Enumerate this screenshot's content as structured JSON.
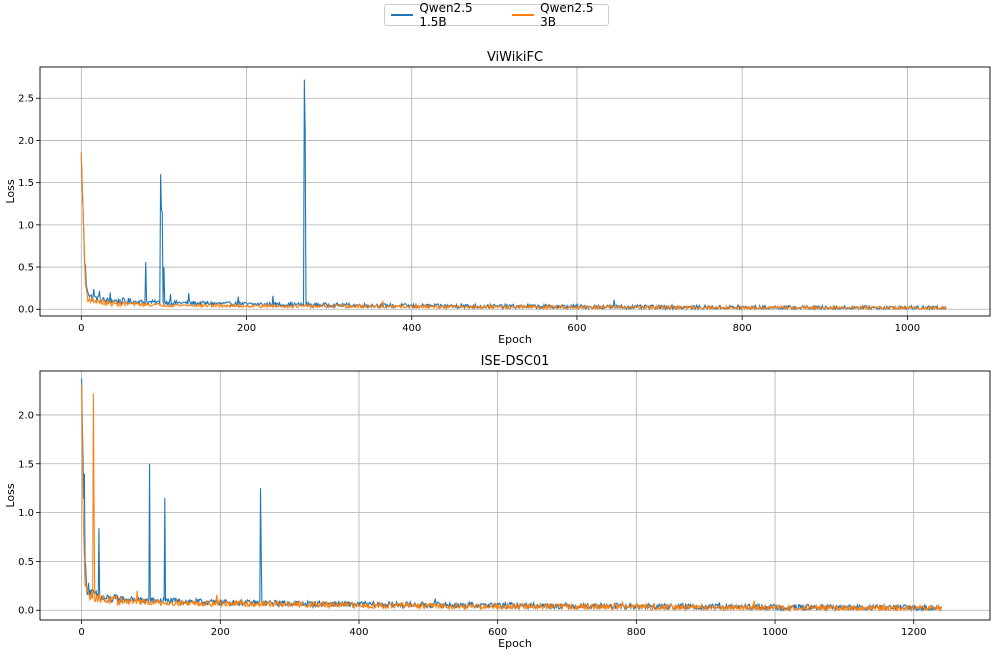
{
  "colors": {
    "series_1": "#1f77b4",
    "series_2": "#ff7f0e",
    "grid": "#b0b0b0",
    "axis": "#000000"
  },
  "legend": {
    "placement": "top-center",
    "items": [
      {
        "label": "Qwen2.5 1.5B",
        "color": "#1f77b4"
      },
      {
        "label": "Qwen2.5 3B",
        "color": "#ff7f0e"
      }
    ]
  },
  "chart_data": [
    {
      "type": "line",
      "title": "ViWikiFC",
      "xlabel": "Epoch",
      "ylabel": "Loss",
      "xlim": [
        -50,
        1100
      ],
      "ylim": [
        -0.08,
        2.87
      ],
      "xticks": [
        0,
        200,
        400,
        600,
        800,
        1000
      ],
      "yticks": [
        0.0,
        0.5,
        1.0,
        1.5,
        2.0,
        2.5
      ],
      "ytick_labels": [
        "0.0",
        "0.5",
        "1.0",
        "1.5",
        "2.0",
        "2.5"
      ],
      "grid": true,
      "series": [
        {
          "name": "Qwen2.5 1.5B",
          "color": "#1f77b4",
          "x_max": 1047,
          "baseline": [
            [
              0,
              1.8
            ],
            [
              3,
              0.9
            ],
            [
              6,
              0.3
            ],
            [
              10,
              0.15
            ],
            [
              30,
              0.1
            ],
            [
              100,
              0.08
            ],
            [
              200,
              0.06
            ],
            [
              300,
              0.05
            ],
            [
              400,
              0.04
            ],
            [
              600,
              0.03
            ],
            [
              800,
              0.02
            ],
            [
              1047,
              0.015
            ]
          ],
          "noise": 0.025,
          "spikes": [
            [
              4,
              0.53
            ],
            [
              15,
              0.24
            ],
            [
              22,
              0.22
            ],
            [
              35,
              0.2
            ],
            [
              78,
              0.56
            ],
            [
              96,
              1.6
            ],
            [
              97,
              1.18
            ],
            [
              98,
              1.15
            ],
            [
              100,
              0.5
            ],
            [
              108,
              0.18
            ],
            [
              130,
              0.19
            ],
            [
              190,
              0.15
            ],
            [
              232,
              0.16
            ],
            [
              270,
              2.72
            ],
            [
              271,
              2.1
            ],
            [
              460,
              0.07
            ],
            [
              645,
              0.11
            ],
            [
              795,
              0.05
            ]
          ]
        },
        {
          "name": "Qwen2.5 3B",
          "color": "#ff7f0e",
          "x_max": 1047,
          "baseline": [
            [
              0,
              1.85
            ],
            [
              2,
              1.2
            ],
            [
              5,
              0.3
            ],
            [
              8,
              0.12
            ],
            [
              30,
              0.07
            ],
            [
              100,
              0.05
            ],
            [
              200,
              0.04
            ],
            [
              400,
              0.03
            ],
            [
              600,
              0.025
            ],
            [
              800,
              0.02
            ],
            [
              1047,
              0.015
            ]
          ],
          "noise": 0.02,
          "spikes": [
            [
              365,
              0.1
            ],
            [
              545,
              0.05
            ]
          ]
        }
      ]
    },
    {
      "type": "line",
      "title": "ISE-DSC01",
      "xlabel": "Epoch",
      "ylabel": "Loss",
      "xlim": [
        -60,
        1310
      ],
      "ylim": [
        -0.1,
        2.45
      ],
      "xticks": [
        0,
        200,
        400,
        600,
        800,
        1000,
        1200
      ],
      "yticks": [
        0.0,
        0.5,
        1.0,
        1.5,
        2.0
      ],
      "ytick_labels": [
        "0.0",
        "0.5",
        "1.0",
        "1.5",
        "2.0"
      ],
      "grid": true,
      "series": [
        {
          "name": "Qwen2.5 1.5B",
          "color": "#1f77b4",
          "x_max": 1240,
          "baseline": [
            [
              0,
              2.35
            ],
            [
              2,
              1.6
            ],
            [
              4,
              0.6
            ],
            [
              8,
              0.2
            ],
            [
              30,
              0.12
            ],
            [
              100,
              0.1
            ],
            [
              200,
              0.08
            ],
            [
              400,
              0.06
            ],
            [
              600,
              0.05
            ],
            [
              800,
              0.04
            ],
            [
              1000,
              0.03
            ],
            [
              1240,
              0.025
            ]
          ],
          "noise": 0.03,
          "spikes": [
            [
              4,
              1.4
            ],
            [
              10,
              0.28
            ],
            [
              25,
              0.84
            ],
            [
              98,
              1.5
            ],
            [
              120,
              1.15
            ],
            [
              258,
              1.25
            ],
            [
              259,
              0.6
            ],
            [
              510,
              0.12
            ],
            [
              920,
              0.08
            ]
          ]
        },
        {
          "name": "Qwen2.5 3B",
          "color": "#ff7f0e",
          "x_max": 1240,
          "baseline": [
            [
              0,
              2.28
            ],
            [
              2,
              1.1
            ],
            [
              5,
              0.3
            ],
            [
              10,
              0.15
            ],
            [
              40,
              0.1
            ],
            [
              100,
              0.08
            ],
            [
              200,
              0.07
            ],
            [
              400,
              0.05
            ],
            [
              600,
              0.04
            ],
            [
              800,
              0.035
            ],
            [
              1000,
              0.025
            ],
            [
              1240,
              0.02
            ]
          ],
          "noise": 0.03,
          "spikes": [
            [
              17,
              2.22
            ],
            [
              18,
              1.0
            ],
            [
              80,
              0.2
            ],
            [
              195,
              0.16
            ],
            [
              780,
              0.08
            ],
            [
              970,
              0.1
            ]
          ]
        }
      ]
    }
  ]
}
